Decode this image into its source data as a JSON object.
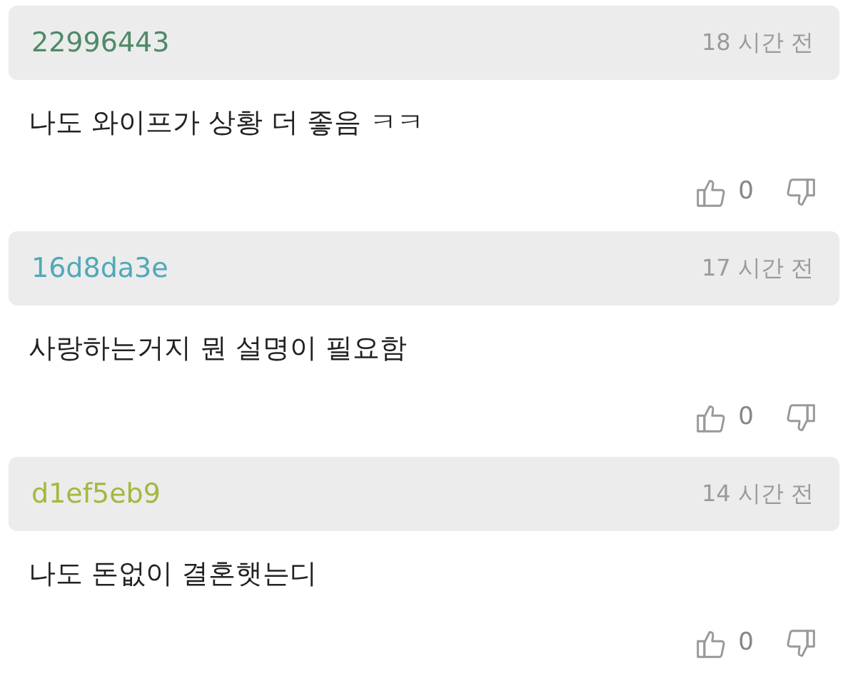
{
  "comments": [
    {
      "author": "22996443",
      "color": "#4f8a68",
      "time": "18 시간 전",
      "text": "나도 와이프가 상황 더 좋음 ㅋㅋ",
      "likes": "0"
    },
    {
      "author": "16d8da3e",
      "color": "#4fa9b8",
      "time": "17 시간 전",
      "text": "사랑하는거지 뭔 설명이 필요함",
      "likes": "0"
    },
    {
      "author": "d1ef5eb9",
      "color": "#a4b83e",
      "time": "14 시간 전",
      "text": "나도 돈없이 결혼햇는디",
      "likes": "0"
    }
  ]
}
